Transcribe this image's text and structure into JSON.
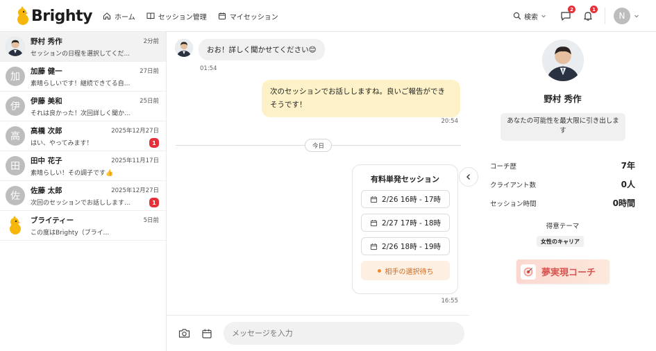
{
  "app": {
    "name": "Brighty"
  },
  "nav": {
    "home": "ホーム",
    "sessions": "セッション管理",
    "my_sessions": "マイセッション"
  },
  "header": {
    "search": "検索",
    "chat_badge": "2",
    "notif_badge": "1",
    "user_initial": "N"
  },
  "conversations": [
    {
      "name": "野村 秀作",
      "time": "2分前",
      "preview": "セッションの日程を選択してくだ...",
      "avatar": "photo",
      "badge": ""
    },
    {
      "name": "加藤 健一",
      "time": "27日前",
      "preview": "素晴らしいです！継続できてる自...",
      "avatar": "加",
      "badge": ""
    },
    {
      "name": "伊藤 美和",
      "time": "25日前",
      "preview": "それは良かった！次回詳しく聞か...",
      "avatar": "伊",
      "badge": ""
    },
    {
      "name": "高橋 次郎",
      "time": "2025年12月27日",
      "preview": "はい、やってみます！",
      "avatar": "高",
      "badge": "1"
    },
    {
      "name": "田中 花子",
      "time": "2025年11月17日",
      "preview": "素晴らしい！その調子です👍",
      "avatar": "田",
      "badge": ""
    },
    {
      "name": "佐藤 太郎",
      "time": "2025年12月27日",
      "preview": "次回のセッションでお話しします...",
      "avatar": "佐",
      "badge": "1"
    },
    {
      "name": "ブライティー",
      "time": "5日前",
      "preview": "この度はBrighty（ブライ...",
      "avatar": "mascot",
      "badge": ""
    }
  ],
  "chat": {
    "incoming_text": "おお！詳しく聞かせてください😊",
    "incoming_time": "01:54",
    "outgoing_text": "次のセッションでお話ししますね。良いご報告ができそうです！",
    "outgoing_time": "20:54",
    "divider": "今日",
    "card": {
      "title": "有料単発セッション",
      "slots": [
        "2/26 16時 - 17時",
        "2/27 17時 - 18時",
        "2/26 18時 - 19時"
      ],
      "status": "相手の選択待ち"
    },
    "card_time": "16:55",
    "input_placeholder": "メッセージを入力"
  },
  "profile": {
    "name": "野村 秀作",
    "tagline": "あなたの可能性を最大限に引き出します",
    "stats": [
      {
        "label": "コーチ歴",
        "value": "7年"
      },
      {
        "label": "クライアント数",
        "value": "0人"
      },
      {
        "label": "セッション時間",
        "value": "0時間"
      }
    ],
    "specialty_label": "得意テーマ",
    "specialty": "女性のキャリア",
    "badge": "夢実現コーチ"
  }
}
